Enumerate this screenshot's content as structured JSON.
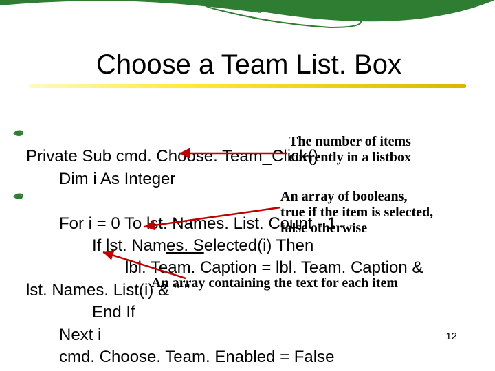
{
  "title": "Choose a Team List. Box",
  "code": {
    "l1": "Private Sub cmd. Choose. Team_Click()",
    "l2": "Dim i As Integer",
    "l3": "For i = 0 To lst. Names. List. Count - 1",
    "l4": "If lst. Names. Selected(i) Then",
    "l5": "lbl. Team. Caption = lbl. Team. Caption &",
    "l6": "lst. Names. List(i) & \" \"",
    "l7": "End If",
    "l8": "Next i",
    "l9": "cmd. Choose. Team. Enabled = False"
  },
  "annotations": {
    "a1_line1": "The number of items",
    "a1_line2": "currently in a listbox",
    "a2_line1": "An array of booleans,",
    "a2_line2": "true if the item is selected,",
    "a2_line3": "false otherwise",
    "a3": "An array containing the text for each item"
  },
  "page_number": "12"
}
